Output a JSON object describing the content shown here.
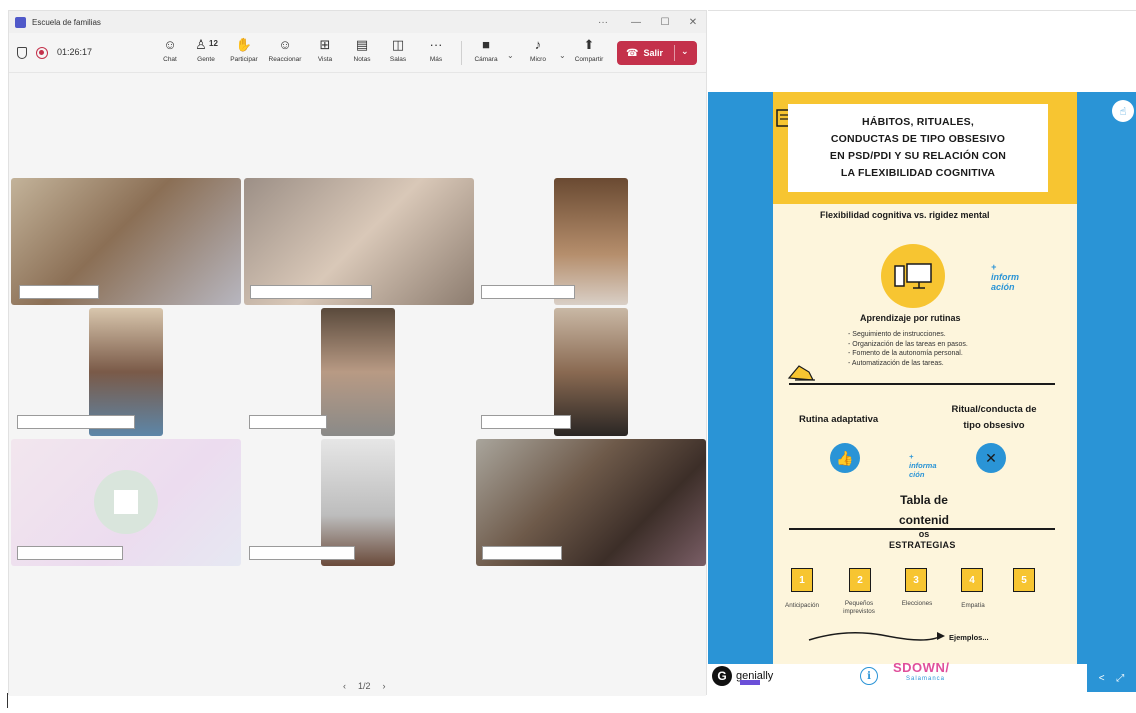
{
  "window": {
    "title": "Escuela de familias",
    "controls": [
      "···",
      "—",
      "☐",
      "✕"
    ]
  },
  "toolbar": {
    "timer": "01:26:17",
    "people_count": "12",
    "buttons": [
      {
        "name": "chat",
        "label": "Chat",
        "icon": "☺"
      },
      {
        "name": "people",
        "label": "Gente",
        "icon": "♙"
      },
      {
        "name": "participate",
        "label": "Participar",
        "icon": "✋"
      },
      {
        "name": "react",
        "label": "Reaccionar",
        "icon": "☺"
      },
      {
        "name": "view",
        "label": "Vista",
        "icon": "⊞"
      },
      {
        "name": "notes",
        "label": "Notas",
        "icon": "▤"
      },
      {
        "name": "rooms",
        "label": "Salas",
        "icon": "◫"
      },
      {
        "name": "more",
        "label": "Más",
        "icon": "···"
      },
      {
        "name": "camera",
        "label": "Cámara",
        "icon": "■"
      },
      {
        "name": "mic",
        "label": "Micro",
        "icon": "♪"
      },
      {
        "name": "share",
        "label": "Compartir",
        "icon": "⬆"
      }
    ],
    "leave_label": "Salir"
  },
  "pager": {
    "prev": "‹",
    "page": "1/2",
    "next": "›"
  },
  "genially": {
    "title_lines": [
      "HÁBITOS, RITUALES,",
      "CONDUCTAS DE TIPO OBSESIVO",
      "EN PSD/PDI Y SU RELACIÓN CON",
      "LA FLEXIBILIDAD COGNITIVA"
    ],
    "subtitle": "Flexibilidad cognitiva vs. rigidez mental",
    "info_link_1": [
      "+",
      "inform",
      "ación"
    ],
    "section_routines": "Aprendizaje por rutinas",
    "routine_items": [
      "- Seguimiento de instrucciones.",
      "- Organización de las tareas en pasos.",
      "- Fomento de la autonomía personal.",
      "- Automatización de las tareas."
    ],
    "adaptive": "Rutina adaptativa",
    "ritual_lines": [
      "Ritual/conducta de",
      "tipo obsesivo"
    ],
    "info_link_2": [
      "+",
      "informa",
      "ción"
    ],
    "table_lines": [
      "Tabla de",
      "contenid",
      "os"
    ],
    "strategies": "ESTRATEGIAS",
    "steps": [
      {
        "num": "1",
        "label": "Anticipación"
      },
      {
        "num": "2",
        "label": "Pequeños imprevistos"
      },
      {
        "num": "3",
        "label": "Elecciones"
      },
      {
        "num": "4",
        "label": "Empatía"
      },
      {
        "num": "5",
        "label": ""
      }
    ],
    "examples": "Ejemplos...",
    "logo_text": "genially",
    "brand_text": "SDOWN/",
    "brand_sub": "Salamanca",
    "colors": {
      "blue": "#2a94d6",
      "yellow": "#f7c531",
      "cream": "#fdf5dc",
      "red": "#c4314b"
    }
  }
}
